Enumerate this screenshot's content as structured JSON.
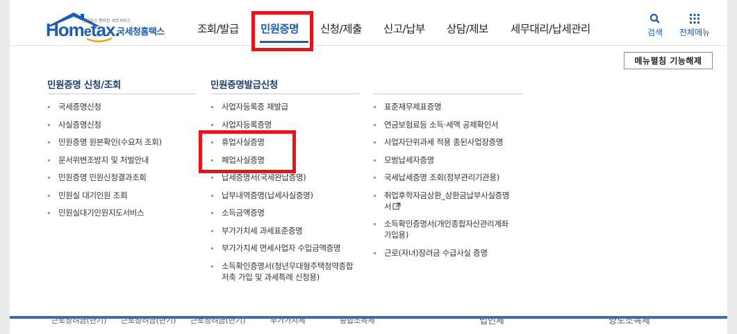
{
  "logo": {
    "tagline": "안전하고 편리한 세무서비스",
    "brand_main": "Hom",
    "brand_e": "e",
    "brand_tax": "tax.",
    "brand_kr": "국세청홈택스"
  },
  "gnb": {
    "items": [
      {
        "label": "조회/발급"
      },
      {
        "label": "민원증명"
      },
      {
        "label": "신청/제출"
      },
      {
        "label": "신고/납부"
      },
      {
        "label": "상담/제보"
      },
      {
        "label": "세무대리/납세관리"
      }
    ],
    "active_index": 1
  },
  "utility": {
    "search_label": "검색",
    "all_menu_label": "전체메뉴"
  },
  "fold_button_label": "메뉴펼침 기능해제",
  "columns": [
    {
      "title": "민원증명 신청/조회",
      "items": [
        "국세증명신청",
        "사실증명신청",
        "민원증명 원본확인(수요처 조회)",
        "문서위변조방지 및 처벌안내",
        "민원증명 민원신청결과조회",
        "민원실 대기인원 조회",
        "민원실대기인원지도서비스"
      ]
    },
    {
      "title": "민원증명발급신청",
      "items": [
        "사업자등록증 재발급",
        "사업자등록증명",
        "휴업사실증명",
        "폐업사실증명",
        "납세증명서(국세완납증명)",
        "납부내역증명(납세사실증명)",
        "소득금액증명",
        "부가가치세 과세표준증명",
        "부가가치세 면세사업자 수입금액증명",
        "소득확인증명서(청년우대형주택청약종합저축 가입 및 과세특례 신청용)"
      ]
    },
    {
      "title": "",
      "items": [
        "표준재무제표증명",
        "연금보험료등 소득·세액 공제확인서",
        "사업자단위과세 적용 종된사업장증명",
        "모범납세자증명",
        "국세납세증명 조회(정부관리기관용)",
        "취업후학자금상환_상환금납부사실증명서",
        "소득확인증명서(개인종합자산관리계좌 가입용)",
        "근로(자녀)장려금 수급사실 증명"
      ]
    }
  ],
  "below_fold": [
    "근로장려금(반기)",
    "근로장려금(반기)",
    "근로장려금(반기)",
    "부가가치세",
    "종합소득세",
    "법인세",
    "양도소득세"
  ],
  "colors": {
    "brand": "#1b5db0",
    "highlight": "#e8141c",
    "column_title": "#1b3e6e"
  }
}
